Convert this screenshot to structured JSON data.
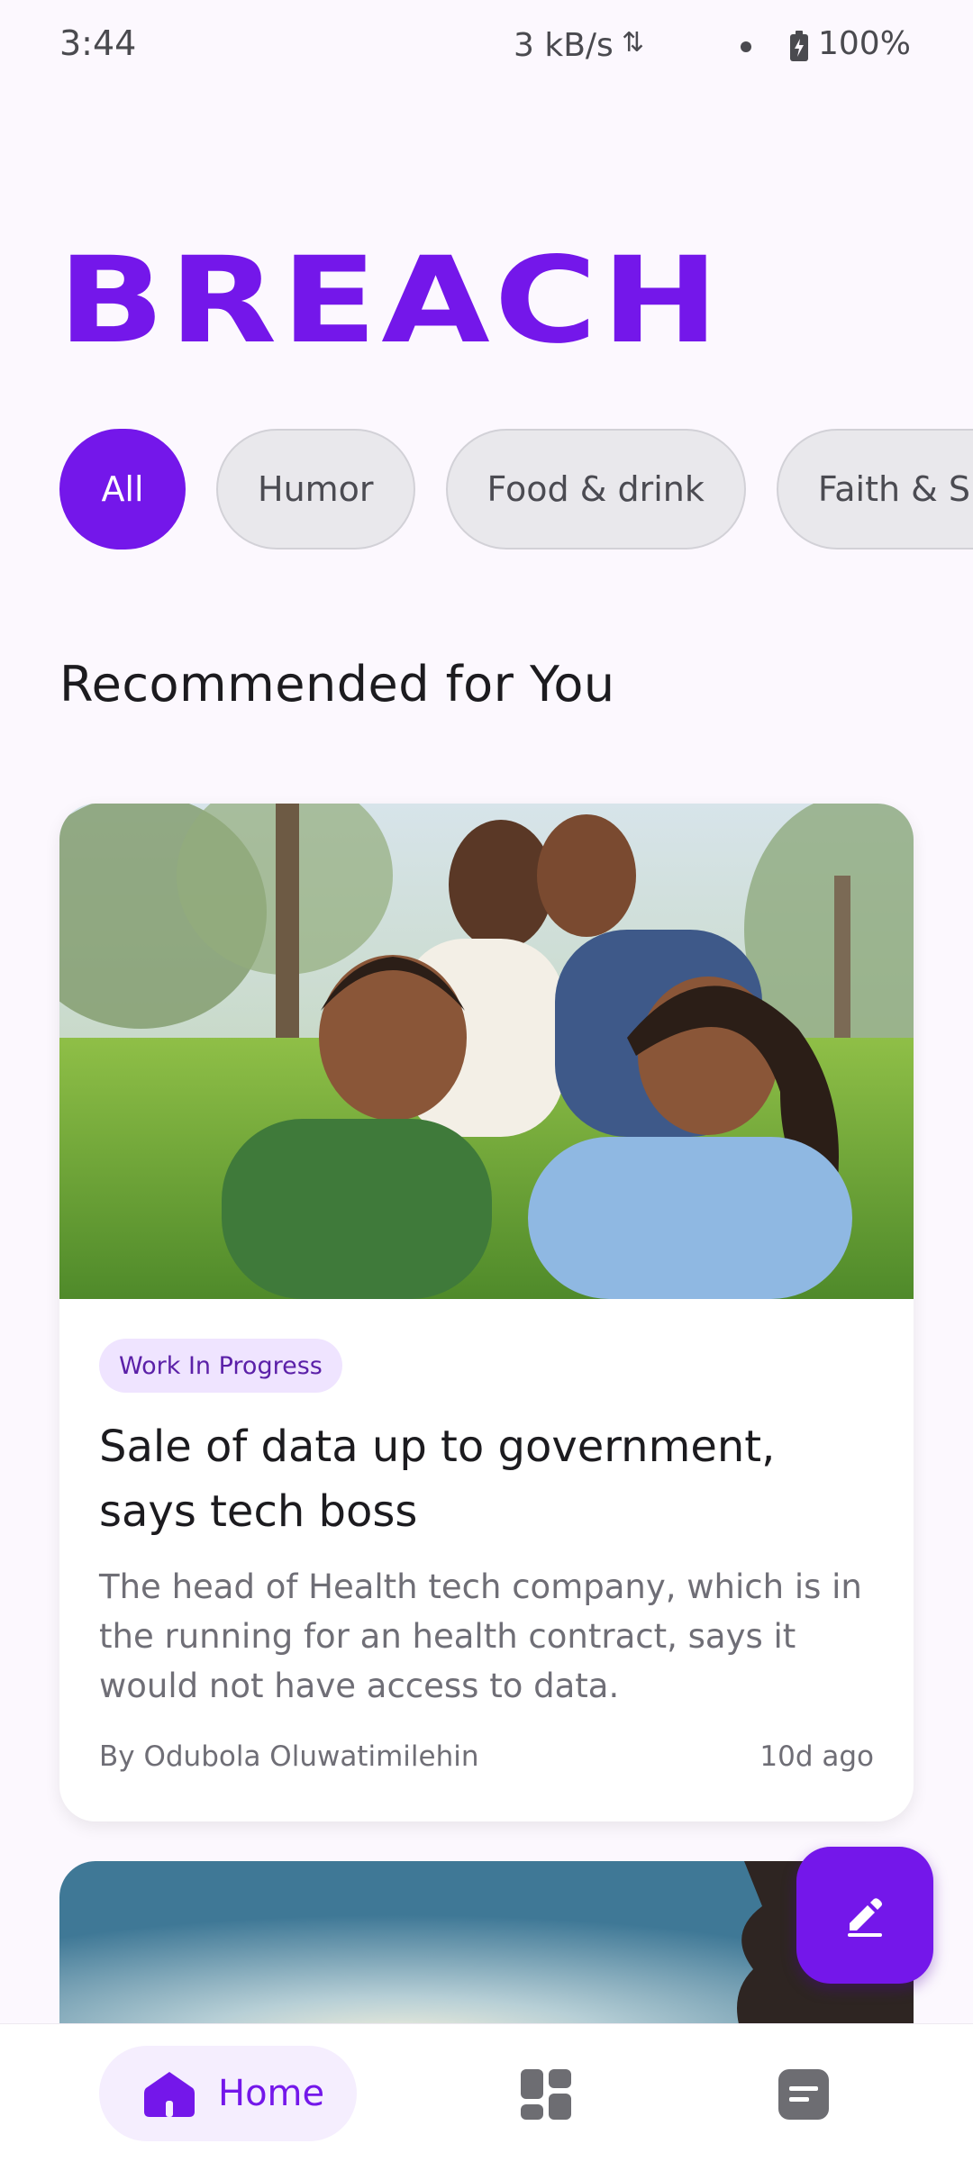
{
  "status_bar": {
    "time": "3:44",
    "network_speed": "3 kB/s",
    "network_arrows": "⇅",
    "battery": "100%"
  },
  "brand": "BREACH",
  "chips": [
    "All",
    "Humor",
    "Food & drink",
    "Faith & Sp"
  ],
  "section_title": "Recommended for You",
  "article": {
    "tag": "Work In Progress",
    "title": "Sale of data up to government, says tech boss",
    "excerpt": "The head of Health tech company, which is in the running for an health contract, says it would not have access to data.",
    "author": "By Odubola Oluwatimilehin",
    "time_ago": "10d ago"
  },
  "nav": {
    "home_label": "Home",
    "icons": [
      "home-icon",
      "dashboard-icon",
      "articles-icon"
    ]
  },
  "fab_icon": "edit-icon",
  "colors": {
    "accent": "#7417EA",
    "background": "#FCF8FE",
    "chip_bg": "#E9E8EC",
    "tag_bg": "#EFE4FF"
  }
}
